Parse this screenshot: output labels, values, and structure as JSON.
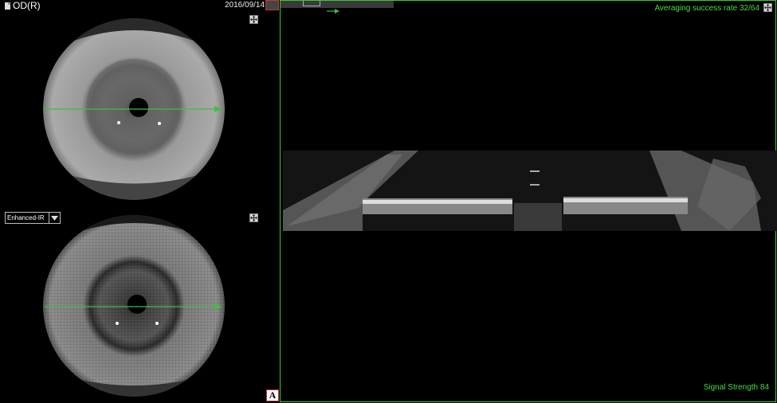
{
  "header": {
    "eye": "OD(R)",
    "date": "2016/09/14"
  },
  "icons": {
    "document": "document-icon",
    "expand": "expand-icon",
    "dropdown_arrow": "chevron-down-icon",
    "scan_arrow": "arrow-right-icon"
  },
  "left_panel": {
    "top_image": {
      "label": "Iris photo (visible light)"
    },
    "mode_select": {
      "value": "Enhanced-IR"
    },
    "bottom_image": {
      "label": "Iris photo (enhanced IR)"
    },
    "anchor_button": {
      "label": "A"
    }
  },
  "right_panel": {
    "averaging": "Averaging success rate 32/64",
    "signal": "Signal Strength 84"
  },
  "colors": {
    "scan_line": "#3fbf3f",
    "status_text": "#44dd44",
    "panel_border": "#33cc33"
  }
}
